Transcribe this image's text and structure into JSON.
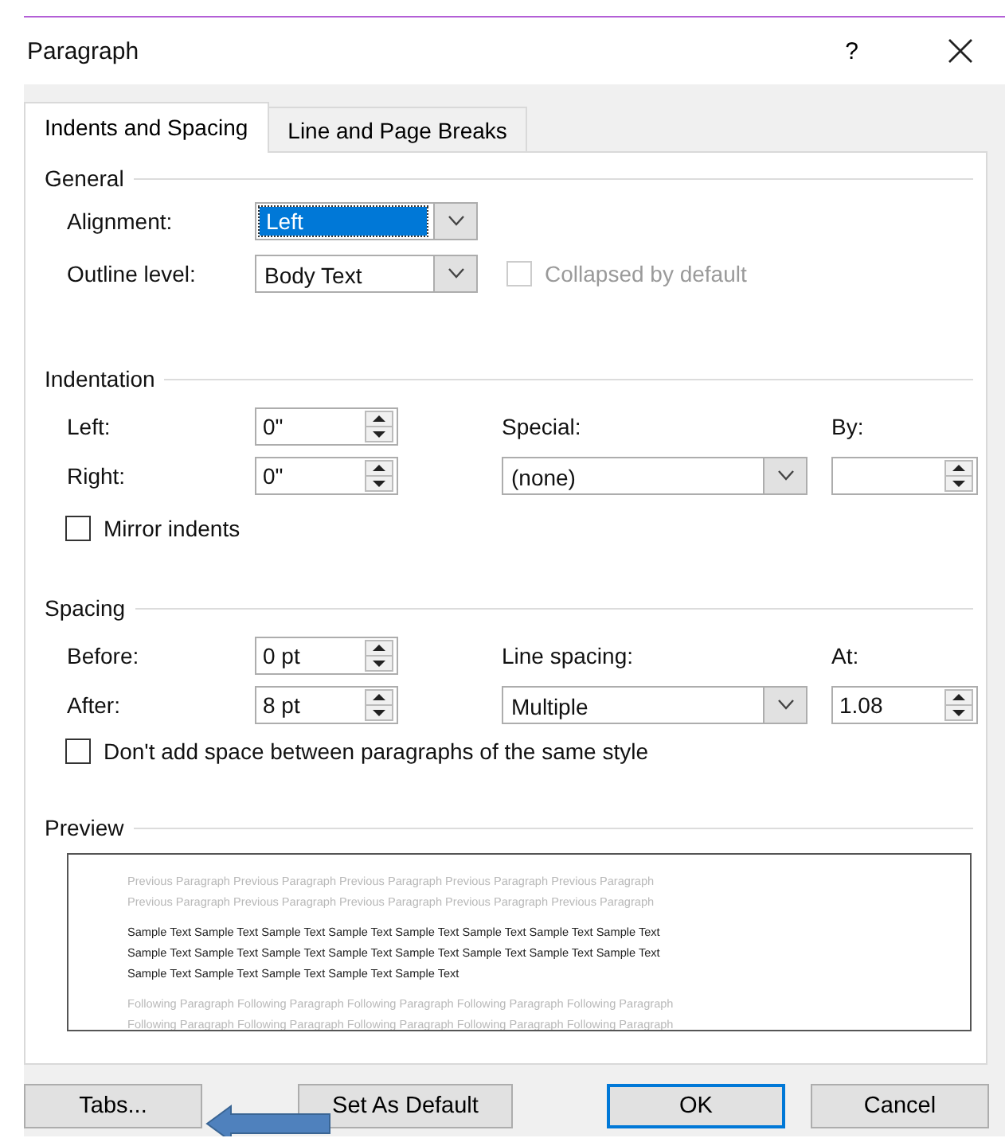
{
  "window": {
    "title": "Paragraph",
    "help": "?"
  },
  "tabs": [
    {
      "label": "Indents and Spacing",
      "selected": true
    },
    {
      "label": "Line and Page Breaks",
      "selected": false
    }
  ],
  "general": {
    "title": "General",
    "alignment": {
      "label": "Alignment:",
      "value": "Left",
      "focused": true
    },
    "outline_level": {
      "label": "Outline level:",
      "value": "Body Text",
      "focused": false
    },
    "collapsed": {
      "label": "Collapsed by default",
      "checked": false,
      "disabled": true
    }
  },
  "indentation": {
    "title": "Indentation",
    "left": {
      "label": "Left:",
      "value": "0\""
    },
    "right": {
      "label": "Right:",
      "value": "0\""
    },
    "special": {
      "label": "Special:",
      "value": "(none)"
    },
    "by": {
      "label": "By:"
    },
    "mirror": {
      "label": "Mirror indents",
      "checked": false,
      "disabled": false
    }
  },
  "spacing": {
    "title": "Spacing",
    "before": {
      "label": "Before:",
      "value": "0 pt"
    },
    "after": {
      "label": "After:",
      "value": "8 pt"
    },
    "line_spacing": {
      "label": "Line spacing:",
      "value": "Multiple"
    },
    "at": {
      "label": "At:",
      "value": "1.08"
    },
    "dont_add": {
      "label": "Don't add space between paragraphs of the same style",
      "checked": false,
      "disabled": false
    }
  },
  "preview": {
    "title": "Preview",
    "previous": [
      "Previous Paragraph Previous Paragraph Previous Paragraph Previous Paragraph Previous Paragraph",
      "Previous Paragraph Previous Paragraph Previous Paragraph Previous Paragraph Previous Paragraph"
    ],
    "sample": [
      "Sample Text Sample Text Sample Text Sample Text Sample Text Sample Text Sample Text Sample Text",
      "Sample Text Sample Text Sample Text Sample Text Sample Text Sample Text Sample Text Sample Text",
      "Sample Text Sample Text Sample Text Sample Text Sample Text"
    ],
    "following": [
      "Following Paragraph Following Paragraph Following Paragraph Following Paragraph Following Paragraph",
      "Following Paragraph Following Paragraph Following Paragraph Following Paragraph Following Paragraph"
    ]
  },
  "buttons": [
    {
      "label": "Tabs...",
      "default": false
    },
    {
      "label": "Set As Default",
      "default": false
    },
    {
      "label": "OK",
      "default": true
    },
    {
      "label": "Cancel",
      "default": false
    }
  ]
}
